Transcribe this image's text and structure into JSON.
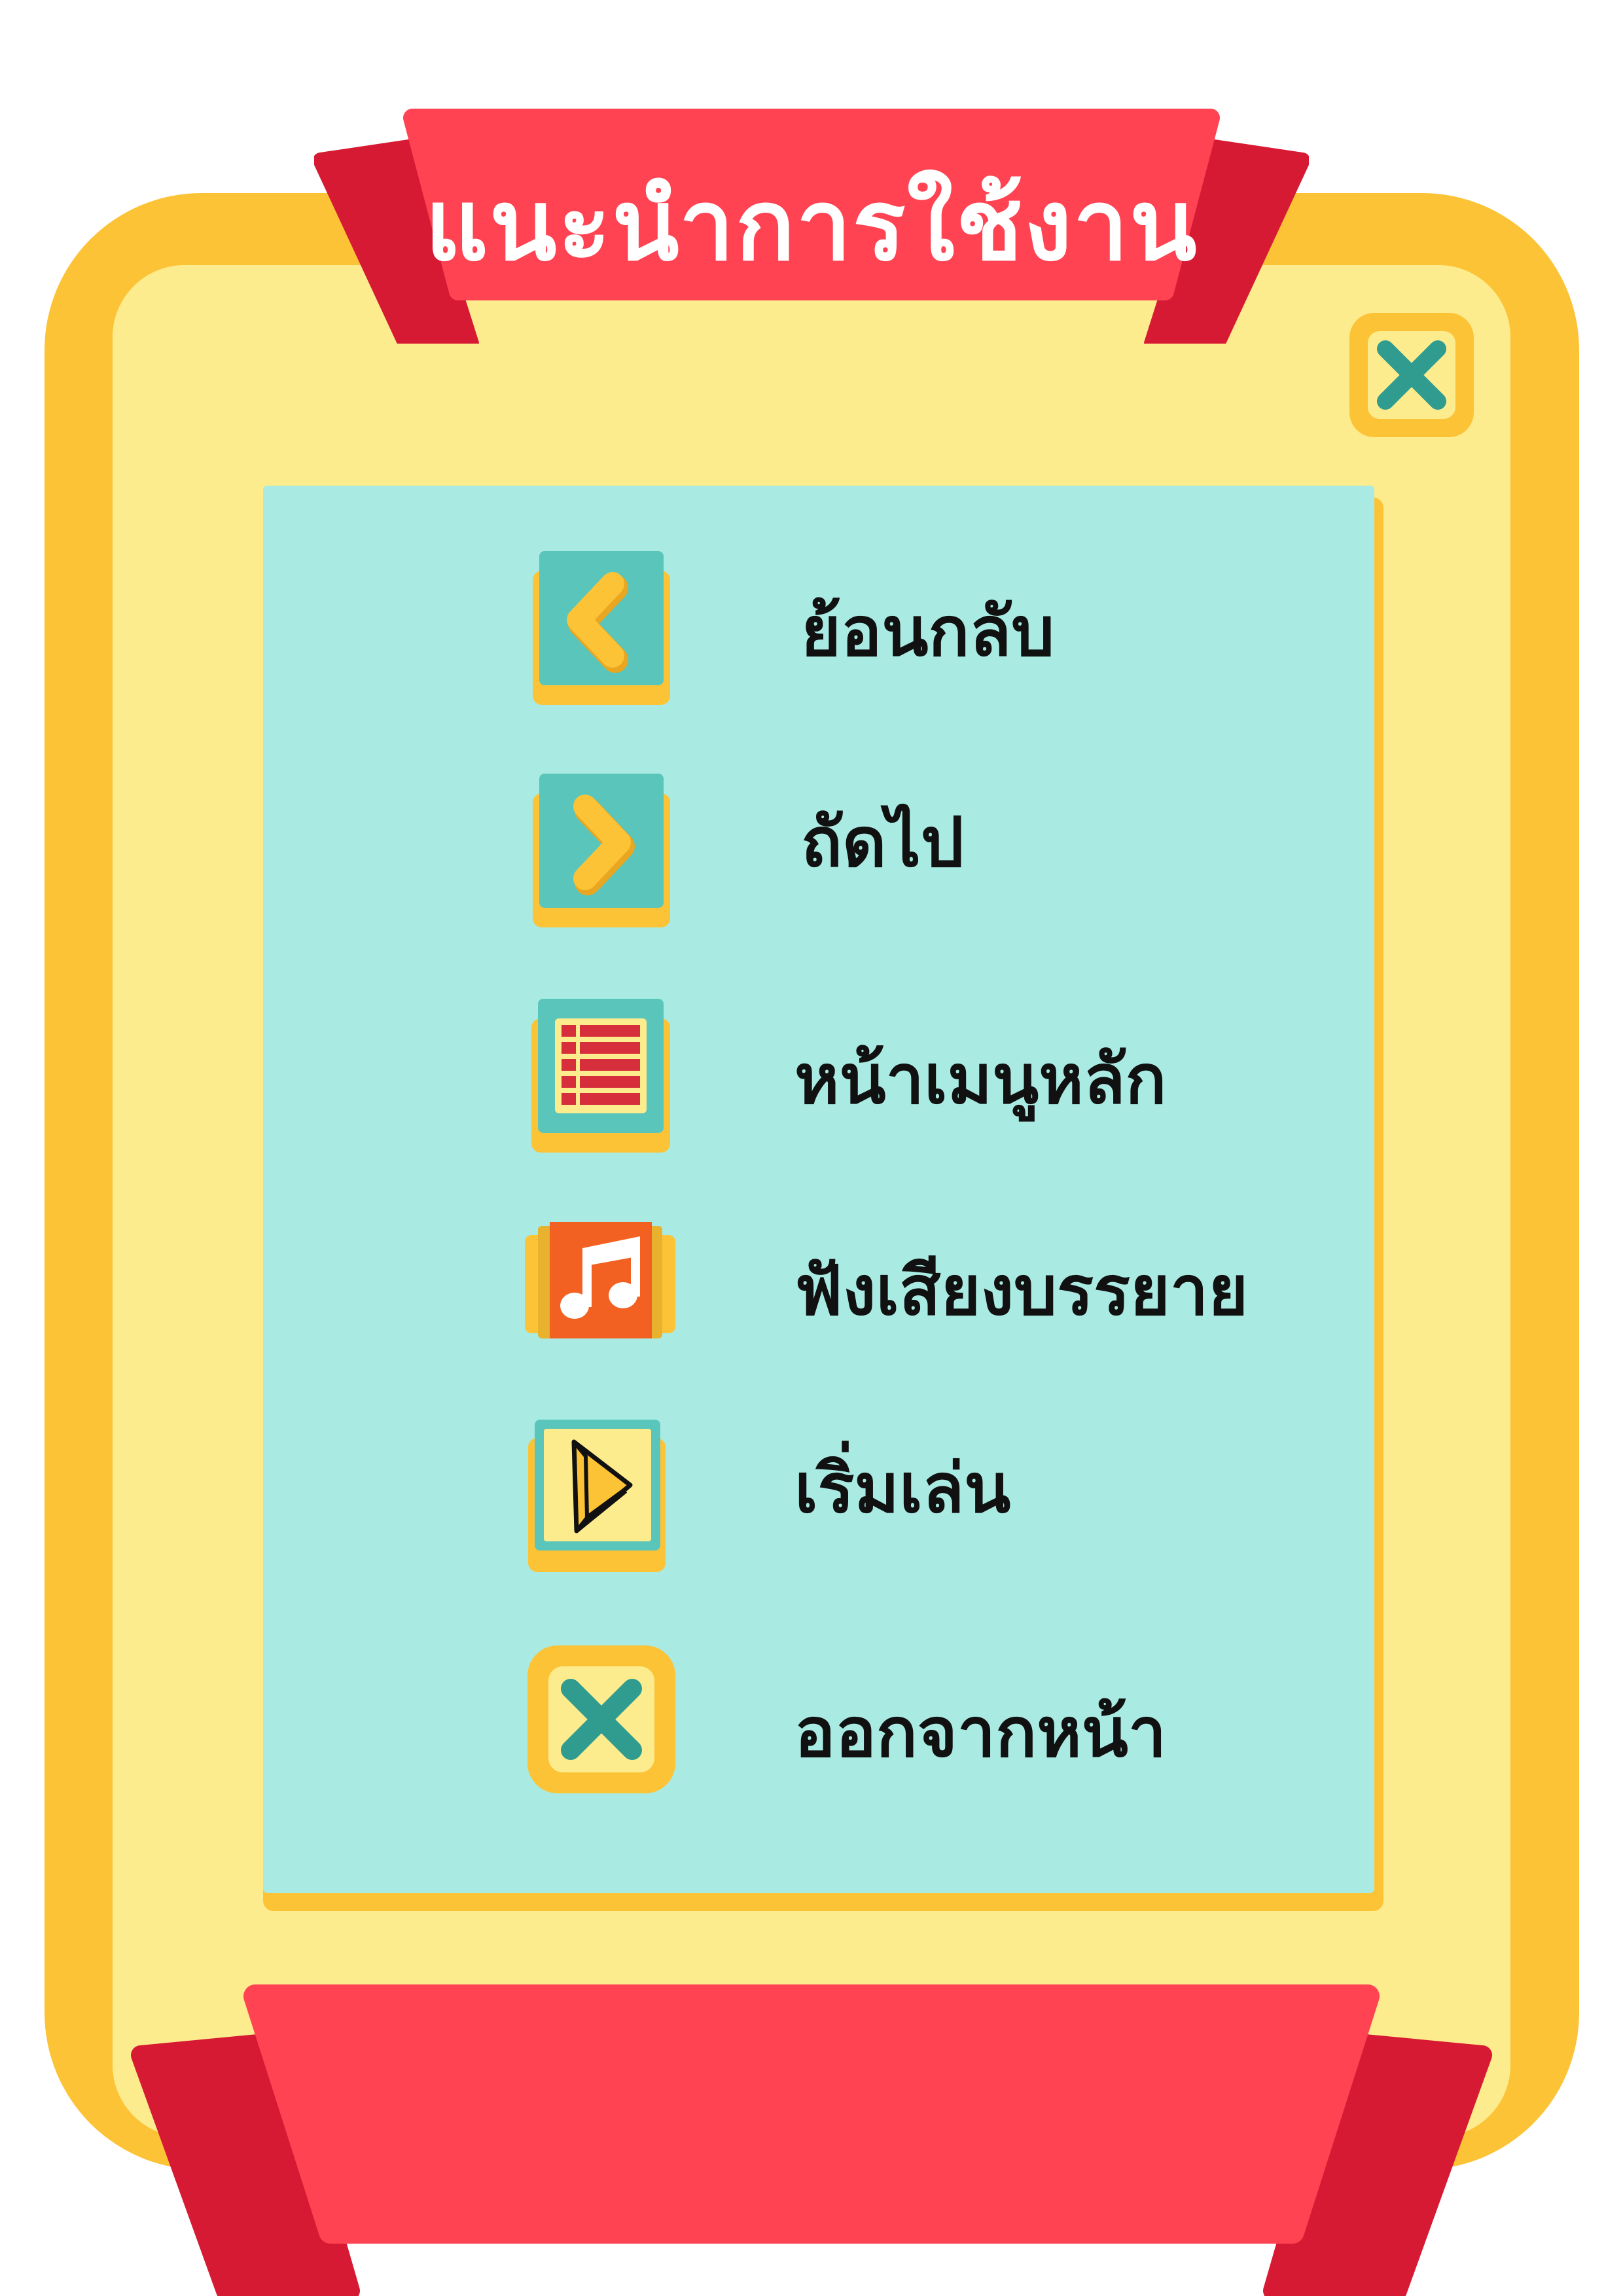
{
  "title": "แนะนำการใช้งาน",
  "colors": {
    "frame_outer": "#FDC337",
    "frame_inner": "#FDEC8E",
    "ribbon_main": "#FF4352",
    "ribbon_fold": "#D71A33",
    "panel": "#A9EBE3",
    "icon_teal": "#5AC5BA",
    "icon_yellow": "#FDC337",
    "close_x": "#2F9C8F",
    "music_orange": "#F26022",
    "menu_red": "#D62E3A"
  },
  "close_button": {
    "icon": "close-icon"
  },
  "guide": [
    {
      "icon": "chevron-left-icon",
      "label": "ย้อนกลับ"
    },
    {
      "icon": "chevron-right-icon",
      "label": "ถัดไป"
    },
    {
      "icon": "menu-list-icon",
      "label": "หน้าเมนูหลัก"
    },
    {
      "icon": "music-note-icon",
      "label": "ฟังเสียงบรรยาย"
    },
    {
      "icon": "play-icon",
      "label": "เริ่มเล่น"
    },
    {
      "icon": "close-icon",
      "label": "ออกจากหน้า"
    }
  ]
}
